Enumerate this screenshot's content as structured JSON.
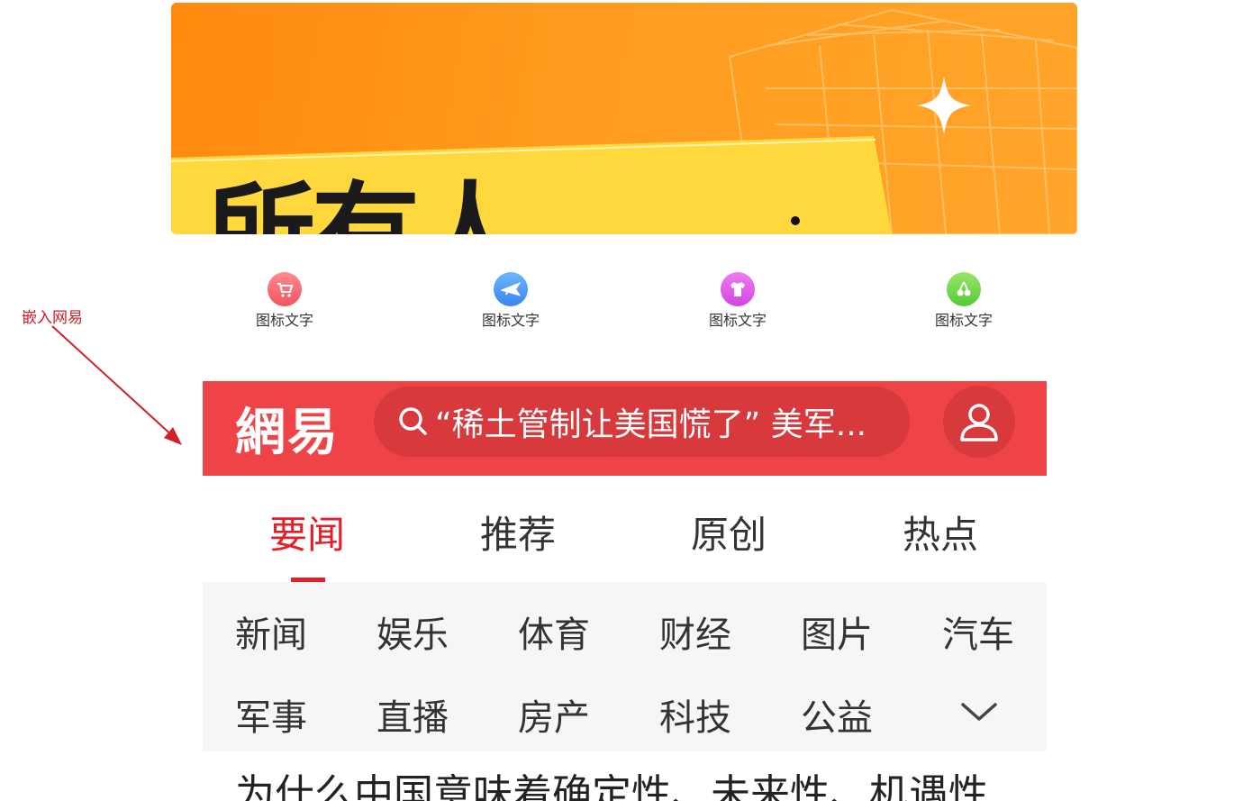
{
  "banner": {
    "artwork_text": "所有人",
    "colors": {
      "bg": "#ff9a1f",
      "card": "#ffd23b"
    }
  },
  "icon_nav": {
    "items": [
      {
        "label": "图标文字",
        "icon": "shopping-cart-icon",
        "color": "#f7656f"
      },
      {
        "label": "图标文字",
        "icon": "airplane-icon",
        "color": "#4a9bf5"
      },
      {
        "label": "图标文字",
        "icon": "tshirt-icon",
        "color": "#e35be8"
      },
      {
        "label": "图标文字",
        "icon": "cherry-icon",
        "color": "#6fd644"
      }
    ]
  },
  "annotation": {
    "label": "嵌入网易",
    "color": "#d0202a"
  },
  "netease": {
    "logo": "網易",
    "search_placeholder": "“稀土管制让美国慌了” 美军...",
    "accent": "#ef4447",
    "tabs": [
      {
        "label": "要闻",
        "active": true
      },
      {
        "label": "推荐",
        "active": false
      },
      {
        "label": "原创",
        "active": false
      },
      {
        "label": "热点",
        "active": false
      }
    ],
    "channels": [
      "新闻",
      "娱乐",
      "体育",
      "财经",
      "图片",
      "汽车",
      "军事",
      "直播",
      "房产",
      "科技",
      "公益"
    ],
    "headline": "为什么中国意味着确定性、未来性、机遇性"
  }
}
